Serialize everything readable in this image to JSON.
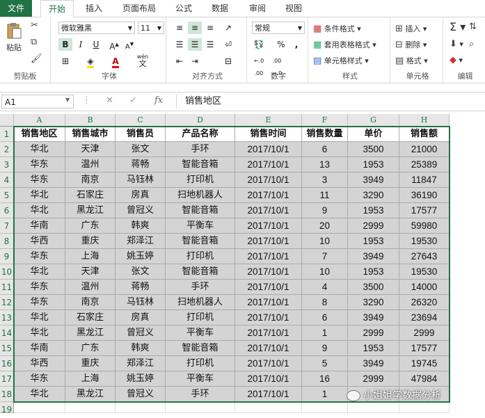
{
  "ribbon": {
    "tabs": [
      "文件",
      "开始",
      "插入",
      "页面布局",
      "公式",
      "数据",
      "审阅",
      "视图"
    ],
    "clipboard": {
      "paste_label": "粘贴",
      "group_label": "剪贴板"
    },
    "font": {
      "name": "微软雅黑",
      "size": "11",
      "bold": "B",
      "italic": "I",
      "underline": "U",
      "group_label": "字体",
      "phonetic": "wén"
    },
    "alignment": {
      "group_label": "对齐方式"
    },
    "number": {
      "format": "常规",
      "group_label": "数字",
      "percent": "%",
      "comma": ","
    },
    "styles": {
      "conditional": "条件格式",
      "table": "套用表格格式",
      "cell": "单元格样式",
      "group_label": "样式"
    },
    "cells": {
      "insert": "插入",
      "delete": "删除",
      "format": "格式",
      "group_label": "单元格"
    },
    "editing": {
      "group_label": "编辑"
    }
  },
  "formula_bar": {
    "name_box": "A1",
    "fx": "fx",
    "content": "销售地区"
  },
  "sheet": {
    "columns": [
      "A",
      "B",
      "C",
      "D",
      "E",
      "F",
      "G",
      "H"
    ],
    "header": [
      "销售地区",
      "销售城市",
      "销售员",
      "产品名称",
      "销售时间",
      "销售数量",
      "单价",
      "销售额"
    ],
    "rows": [
      [
        "华北",
        "天津",
        "张文",
        "手环",
        "2017/10/1",
        "6",
        "3500",
        "21000"
      ],
      [
        "华东",
        "温州",
        "蒋畅",
        "智能音箱",
        "2017/10/1",
        "13",
        "1953",
        "25389"
      ],
      [
        "华东",
        "南京",
        "马钰林",
        "打印机",
        "2017/10/1",
        "3",
        "3949",
        "11847"
      ],
      [
        "华北",
        "石家庄",
        "房真",
        "扫地机器人",
        "2017/10/1",
        "11",
        "3290",
        "36190"
      ],
      [
        "华北",
        "黑龙江",
        "曾冠义",
        "智能音箱",
        "2017/10/1",
        "9",
        "1953",
        "17577"
      ],
      [
        "华南",
        "广东",
        "韩爽",
        "平衡车",
        "2017/10/1",
        "20",
        "2999",
        "59980"
      ],
      [
        "华西",
        "重庆",
        "郑泽江",
        "智能音箱",
        "2017/10/1",
        "10",
        "1953",
        "19530"
      ],
      [
        "华东",
        "上海",
        "姚玉婷",
        "打印机",
        "2017/10/1",
        "7",
        "3949",
        "27643"
      ],
      [
        "华北",
        "天津",
        "张文",
        "智能音箱",
        "2017/10/1",
        "10",
        "1953",
        "19530"
      ],
      [
        "华东",
        "温州",
        "蒋畅",
        "手环",
        "2017/10/1",
        "4",
        "3500",
        "14000"
      ],
      [
        "华东",
        "南京",
        "马钰林",
        "扫地机器人",
        "2017/10/1",
        "8",
        "3290",
        "26320"
      ],
      [
        "华北",
        "石家庄",
        "房真",
        "打印机",
        "2017/10/1",
        "6",
        "3949",
        "23694"
      ],
      [
        "华北",
        "黑龙江",
        "曾冠义",
        "平衡车",
        "2017/10/1",
        "1",
        "2999",
        "2999"
      ],
      [
        "华南",
        "广东",
        "韩爽",
        "智能音箱",
        "2017/10/1",
        "9",
        "1953",
        "17577"
      ],
      [
        "华西",
        "重庆",
        "郑泽江",
        "打印机",
        "2017/10/1",
        "5",
        "3949",
        "19745"
      ],
      [
        "华东",
        "上海",
        "姚玉婷",
        "平衡车",
        "2017/10/1",
        "16",
        "2999",
        "47984"
      ],
      [
        "华北",
        "黑龙江",
        "曾冠义",
        "手环",
        "2017/10/1",
        "1",
        "",
        ""
      ]
    ],
    "row_numbers": [
      "1",
      "2",
      "3",
      "4",
      "5",
      "6",
      "7",
      "8",
      "9",
      "10",
      "11",
      "12",
      "13",
      "14",
      "15",
      "16",
      "17",
      "18",
      "19"
    ]
  },
  "watermark": "小姐姐学数据分析",
  "colors": {
    "accent": "#217346",
    "cell_fill": "#d4d4d4"
  }
}
